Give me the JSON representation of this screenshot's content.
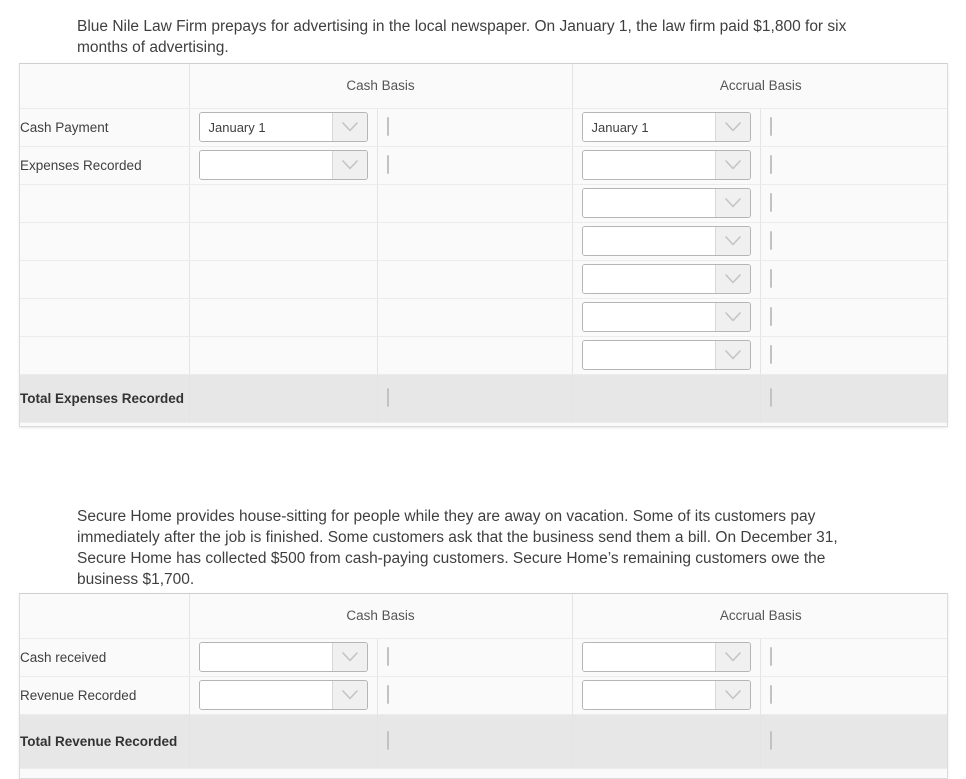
{
  "problems": [
    {
      "id": "blue-nile",
      "prompt": "Blue Nile Law Firm prepays for advertising in the local newspaper. On January 1, the law firm paid $1,800 for six months of advertising.",
      "table": {
        "headers": {
          "corner": "",
          "cash_basis": "Cash Basis",
          "accrual_basis": "Accrual Basis"
        },
        "rows": [
          {
            "label": "Cash Payment",
            "cash_select": "January 1",
            "cash_amount": "",
            "accrual_select": "January 1",
            "accrual_amount": "",
            "cash_has_controls": true,
            "accrual_has_controls": true
          },
          {
            "label": "Expenses Recorded",
            "cash_select": "",
            "cash_amount": "",
            "accrual_select": "",
            "accrual_amount": "",
            "cash_has_controls": true,
            "accrual_has_controls": true
          },
          {
            "label": "",
            "cash_select": "",
            "cash_amount": "",
            "accrual_select": "",
            "accrual_amount": "",
            "cash_has_controls": false,
            "accrual_has_controls": true
          },
          {
            "label": "",
            "cash_select": "",
            "cash_amount": "",
            "accrual_select": "",
            "accrual_amount": "",
            "cash_has_controls": false,
            "accrual_has_controls": true
          },
          {
            "label": "",
            "cash_select": "",
            "cash_amount": "",
            "accrual_select": "",
            "accrual_amount": "",
            "cash_has_controls": false,
            "accrual_has_controls": true
          },
          {
            "label": "",
            "cash_select": "",
            "cash_amount": "",
            "accrual_select": "",
            "accrual_amount": "",
            "cash_has_controls": false,
            "accrual_has_controls": true
          },
          {
            "label": "",
            "cash_select": "",
            "cash_amount": "",
            "accrual_select": "",
            "accrual_amount": "",
            "cash_has_controls": false,
            "accrual_has_controls": true
          }
        ],
        "total_row": {
          "label": "Total Expenses Recorded",
          "cash_total": "",
          "accrual_total": ""
        }
      }
    },
    {
      "id": "secure-home",
      "prompt": "Secure Home provides house-sitting for people while they are away on vacation. Some of its customers pay immediately after the job is finished. Some customers ask that the business send them a bill. On December 31, Secure Home has collected $500 from cash-paying customers. Secure Home’s remaining customers owe the business $1,700.",
      "table": {
        "headers": {
          "corner": "",
          "cash_basis": "Cash Basis",
          "accrual_basis": "Accrual Basis"
        },
        "rows": [
          {
            "label": "Cash received",
            "cash_select": "",
            "cash_amount": "",
            "accrual_select": "",
            "accrual_amount": "",
            "cash_has_controls": true,
            "accrual_has_controls": true
          },
          {
            "label": "Revenue Recorded",
            "cash_select": "",
            "cash_amount": "",
            "accrual_select": "",
            "accrual_amount": "",
            "cash_has_controls": true,
            "accrual_has_controls": true
          }
        ],
        "total_row": {
          "label": "Total Revenue Recorded",
          "cash_total": "",
          "accrual_total": ""
        }
      }
    }
  ],
  "icons": {
    "dropdown": "chevron-down-icon"
  },
  "colors": {
    "page_background": "#ffffff",
    "table_background": "#fafafa",
    "total_row_background": "#e7e7e7",
    "text": "#3f3f3f",
    "border": "#e4e4e4",
    "rule": "#6e6e6e"
  }
}
